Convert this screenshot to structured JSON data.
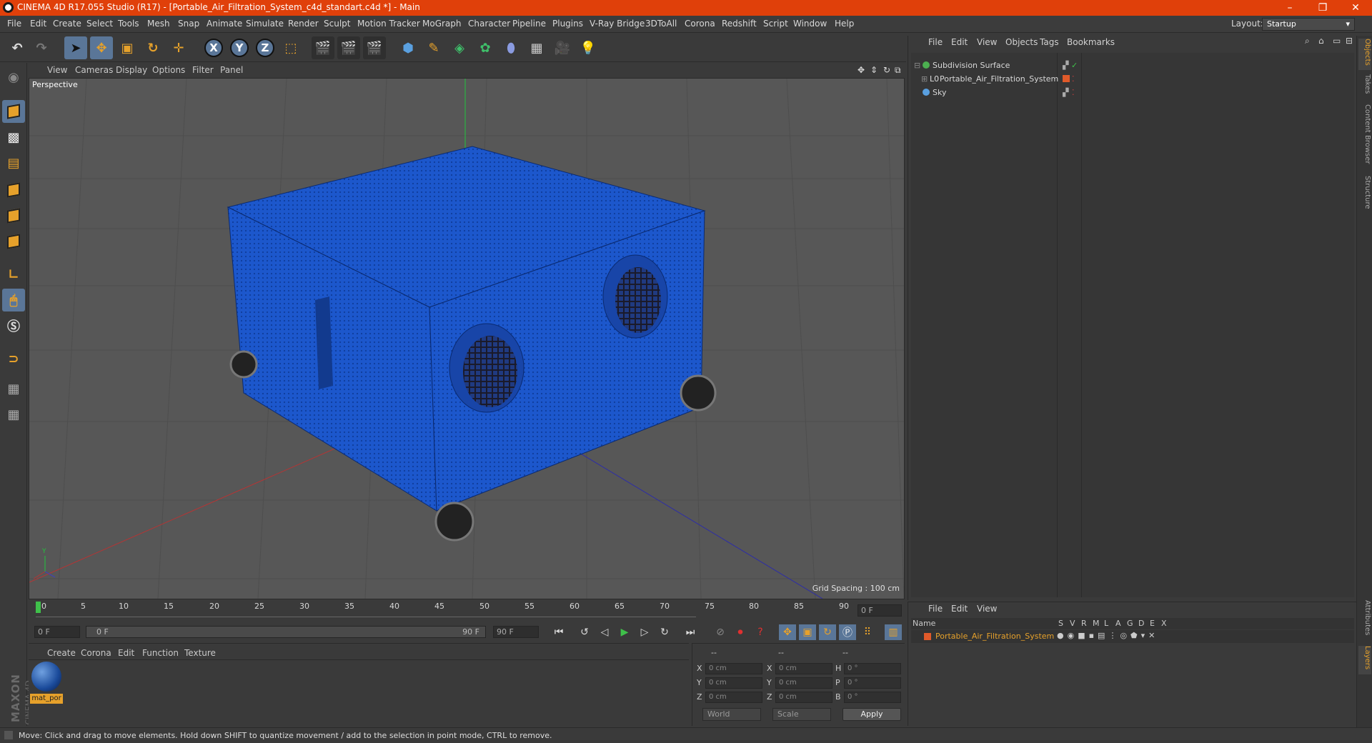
{
  "window": {
    "title": "CINEMA 4D R17.055 Studio (R17) - [Portable_Air_Filtration_System_c4d_standart.c4d *] - Main",
    "controls": [
      "–",
      "❐",
      "✕"
    ]
  },
  "menubar": {
    "items": [
      "File",
      "Edit",
      "Create",
      "Select",
      "Tools",
      "Mesh",
      "Snap",
      "Animate",
      "Simulate",
      "Render",
      "Sculpt",
      "Motion Tracker",
      "MoGraph",
      "Character",
      "Pipeline",
      "Plugins",
      "V-Ray Bridge",
      "3DToAll",
      "Corona",
      "Redshift",
      "Script",
      "Window",
      "Help"
    ],
    "layout_label": "Layout:",
    "layout_value": "Startup"
  },
  "toolbar": {
    "axis_x": "X",
    "axis_y": "Y",
    "axis_z": "Z"
  },
  "viewport": {
    "menu": [
      "View",
      "Cameras",
      "Display",
      "Options",
      "Filter",
      "Panel"
    ],
    "label": "Perspective",
    "grid_spacing": "Grid Spacing : 100 cm"
  },
  "timeline": {
    "ticks": [
      "0",
      "5",
      "10",
      "15",
      "20",
      "25",
      "30",
      "35",
      "40",
      "45",
      "50",
      "55",
      "60",
      "65",
      "70",
      "75",
      "80",
      "85",
      "90"
    ],
    "frame_end_field": "0 F",
    "current_frame": "0 F",
    "range_start": "0 F",
    "range_end": "90 F",
    "max_frame": "90 F"
  },
  "material_panel": {
    "menu": [
      "Create",
      "Corona",
      "Edit",
      "Function",
      "Texture"
    ],
    "material_name": "mat_por"
  },
  "coordinates": {
    "headers": [
      "--",
      "--",
      "--"
    ],
    "rows": [
      {
        "a": "X",
        "av": "0 cm",
        "b": "X",
        "bv": "0 cm",
        "c": "H",
        "cv": "0 °"
      },
      {
        "a": "Y",
        "av": "0 cm",
        "b": "Y",
        "bv": "0 cm",
        "c": "P",
        "cv": "0 °"
      },
      {
        "a": "Z",
        "av": "0 cm",
        "b": "Z",
        "bv": "0 cm",
        "c": "B",
        "cv": "0 °"
      }
    ],
    "mode": "World",
    "type": "Scale",
    "apply": "Apply"
  },
  "branding": {
    "line1": "MAXON",
    "line2": "CINEMA 4D"
  },
  "status": "Move: Click and drag to move elements. Hold down SHIFT to quantize movement / add to the selection in point mode, CTRL to remove.",
  "object_manager": {
    "menu": [
      "File",
      "Edit",
      "View",
      "Objects",
      "Tags",
      "Bookmarks"
    ],
    "objects": [
      {
        "name": "Subdivision Surface",
        "color": "#4caf50"
      },
      {
        "name": "Portable_Air_Filtration_System",
        "color": "#e0e0e0"
      },
      {
        "name": "Sky",
        "color": "#5aa0e0"
      }
    ]
  },
  "side_tabs": [
    "Objects",
    "Takes",
    "Content Browser",
    "Structure",
    "Attributes",
    "Layers"
  ],
  "layer_manager": {
    "menu": [
      "File",
      "Edit",
      "View"
    ],
    "columns": [
      "Name",
      "S",
      "V",
      "R",
      "M",
      "L",
      "A",
      "G",
      "D",
      "E",
      "X"
    ],
    "layer_name": "Portable_Air_Filtration_System",
    "layer_color": "#e05a2a"
  },
  "colors": {
    "accent": "#e6a12b",
    "titlebar": "#e0400a",
    "selected": "#5a7698",
    "model": "#1a55c8"
  }
}
